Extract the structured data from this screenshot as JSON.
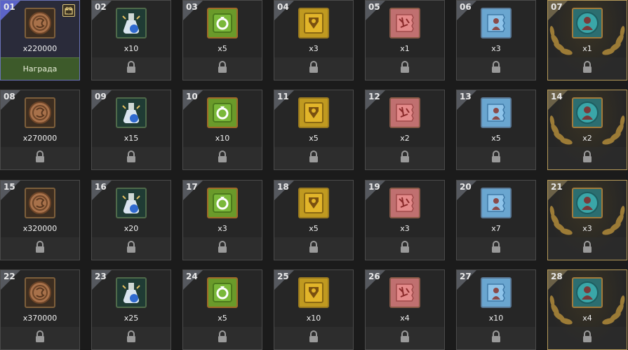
{
  "claim_label": "Награда",
  "colors": {
    "claim_border": "#6a73b8",
    "claim_bg": "#3d5a2a",
    "gold_border": "#b59a5a"
  },
  "days": [
    {
      "n": "01",
      "qty": "x220000",
      "item": "coin-icon",
      "state": "claimable"
    },
    {
      "n": "02",
      "qty": "x10",
      "item": "potion-icon",
      "state": "locked"
    },
    {
      "n": "03",
      "qty": "x5",
      "item": "green-scroll-icon",
      "state": "locked"
    },
    {
      "n": "04",
      "qty": "x3",
      "item": "gold-chest-icon",
      "state": "locked"
    },
    {
      "n": "05",
      "qty": "x1",
      "item": "red-scroll-icon",
      "state": "locked"
    },
    {
      "n": "06",
      "qty": "x3",
      "item": "blue-scroll-icon",
      "state": "locked"
    },
    {
      "n": "07",
      "qty": "x1",
      "item": "teal-seal-icon",
      "state": "locked",
      "gold": true
    },
    {
      "n": "08",
      "qty": "x270000",
      "item": "coin-icon",
      "state": "locked"
    },
    {
      "n": "09",
      "qty": "x15",
      "item": "potion-icon",
      "state": "locked"
    },
    {
      "n": "10",
      "qty": "x10",
      "item": "green-scroll-icon",
      "state": "locked"
    },
    {
      "n": "11",
      "qty": "x5",
      "item": "gold-chest-icon",
      "state": "locked"
    },
    {
      "n": "12",
      "qty": "x2",
      "item": "red-scroll-icon",
      "state": "locked"
    },
    {
      "n": "13",
      "qty": "x5",
      "item": "blue-scroll-icon",
      "state": "locked"
    },
    {
      "n": "14",
      "qty": "x2",
      "item": "teal-seal-icon",
      "state": "locked",
      "gold": true
    },
    {
      "n": "15",
      "qty": "x320000",
      "item": "coin-icon",
      "state": "locked"
    },
    {
      "n": "16",
      "qty": "x20",
      "item": "potion-icon",
      "state": "locked"
    },
    {
      "n": "17",
      "qty": "x3",
      "item": "green-scroll-icon",
      "state": "locked"
    },
    {
      "n": "18",
      "qty": "x5",
      "item": "gold-chest-icon",
      "state": "locked"
    },
    {
      "n": "19",
      "qty": "x3",
      "item": "red-scroll-icon",
      "state": "locked"
    },
    {
      "n": "20",
      "qty": "x7",
      "item": "blue-scroll-icon",
      "state": "locked"
    },
    {
      "n": "21",
      "qty": "x3",
      "item": "teal-seal-icon",
      "state": "locked",
      "gold": true
    },
    {
      "n": "22",
      "qty": "x370000",
      "item": "coin-icon",
      "state": "locked"
    },
    {
      "n": "23",
      "qty": "x25",
      "item": "potion-icon",
      "state": "locked"
    },
    {
      "n": "24",
      "qty": "x5",
      "item": "green-scroll-icon",
      "state": "locked"
    },
    {
      "n": "25",
      "qty": "x10",
      "item": "gold-chest-icon",
      "state": "locked"
    },
    {
      "n": "26",
      "qty": "x4",
      "item": "red-scroll-icon",
      "state": "locked"
    },
    {
      "n": "27",
      "qty": "x10",
      "item": "blue-scroll-icon",
      "state": "locked"
    },
    {
      "n": "28",
      "qty": "x4",
      "item": "teal-seal-icon",
      "state": "locked",
      "gold": true
    }
  ]
}
